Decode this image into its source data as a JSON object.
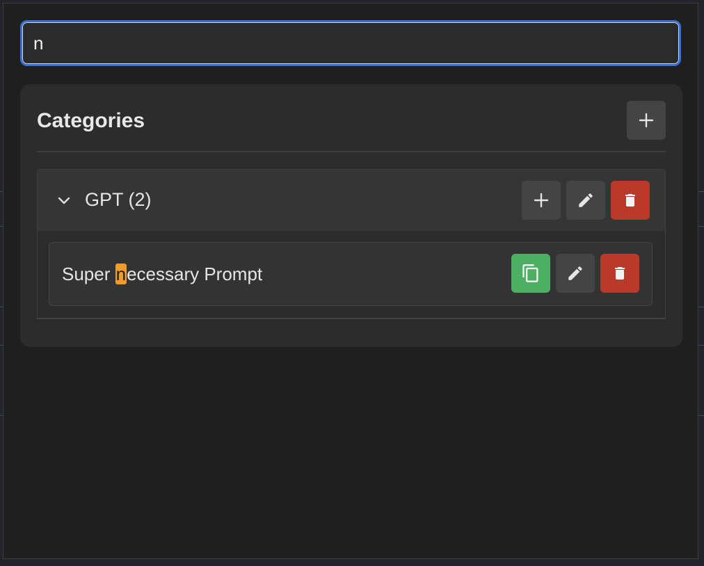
{
  "search": {
    "value": "n"
  },
  "categories_panel": {
    "title": "Categories",
    "add_button_icon": "plus-icon"
  },
  "category": {
    "label": "GPT (2)",
    "expanded": true,
    "actions": {
      "add_icon": "plus-icon",
      "edit_icon": "pencil-icon",
      "delete_icon": "trash-icon"
    }
  },
  "prompt": {
    "text_before": "Super ",
    "text_highlight": "n",
    "text_after": "ecessary Prompt",
    "actions": {
      "copy_icon": "copy-icon",
      "edit_icon": "pencil-icon",
      "delete_icon": "trash-icon"
    }
  },
  "colors": {
    "focus_border": "#3b6fd6",
    "highlight": "#ef9b2d",
    "delete": "#b93a2b",
    "copy": "#4caf63",
    "neutral_button": "#444444"
  }
}
